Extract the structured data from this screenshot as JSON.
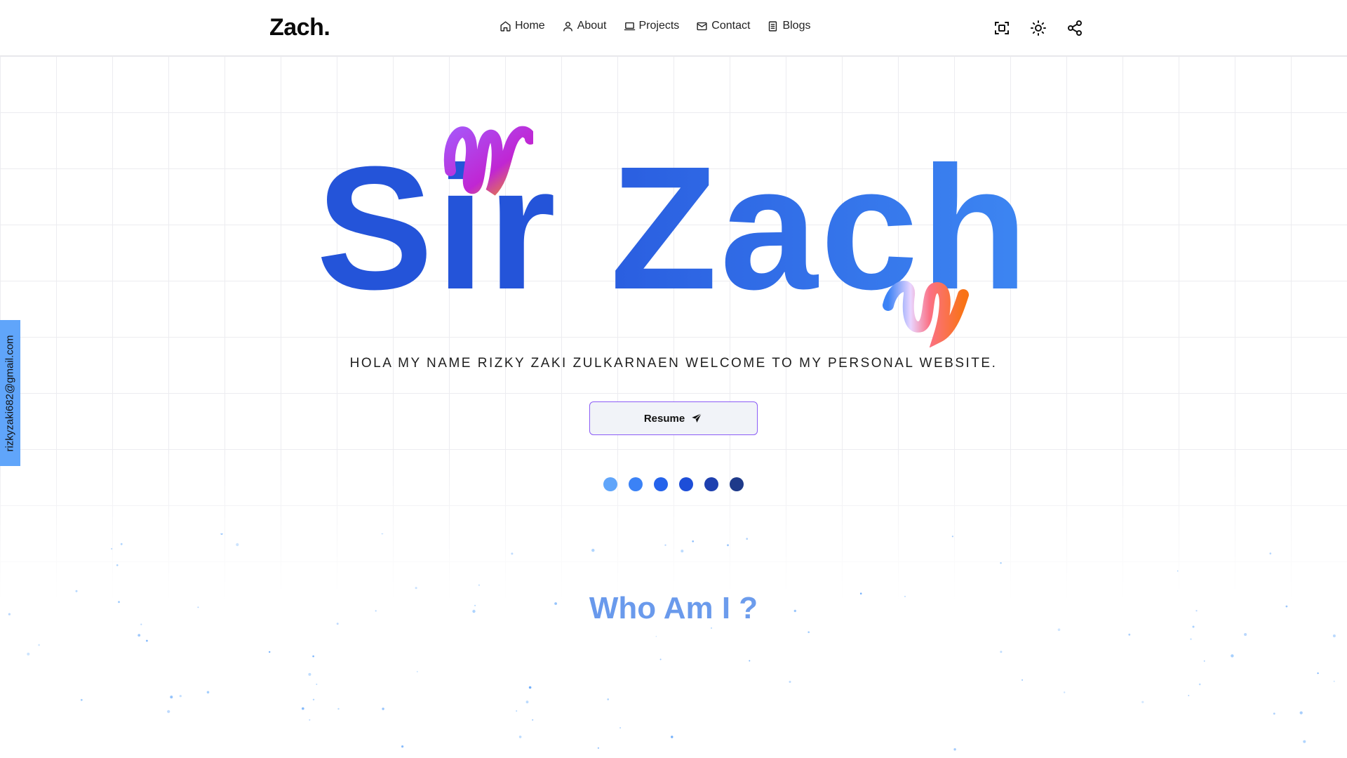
{
  "header": {
    "logo": "Zach.",
    "nav": [
      {
        "label": "Home",
        "icon": "home-icon"
      },
      {
        "label": "About",
        "icon": "user-icon"
      },
      {
        "label": "Projects",
        "icon": "laptop-icon"
      },
      {
        "label": "Contact",
        "icon": "mail-icon"
      },
      {
        "label": "Blogs",
        "icon": "document-icon"
      }
    ],
    "tools": [
      {
        "name": "focus-frame-icon"
      },
      {
        "name": "sun-icon"
      },
      {
        "name": "share-icon"
      }
    ]
  },
  "side": {
    "email": "rizkyzaki682@gmail.com"
  },
  "hero": {
    "title_word1": "Sir",
    "title_word2": "Zach",
    "tagline": "HOLA MY NAME RIZKY ZAKI ZULKARNAEN WELCOME TO MY PERSONAL WEBSITE.",
    "resume_label": "Resume",
    "resume_icon": "send-icon",
    "dot_colors": [
      "#60a5fa",
      "#3b82f6",
      "#2563eb",
      "#1d4ed8",
      "#1e40af",
      "#1e3a8a"
    ]
  },
  "about": {
    "title": "Who Am I ?"
  },
  "colors": {
    "accent": "#2563eb",
    "sidebar": "#60a5fa",
    "button_border": "#8b5cf6"
  }
}
